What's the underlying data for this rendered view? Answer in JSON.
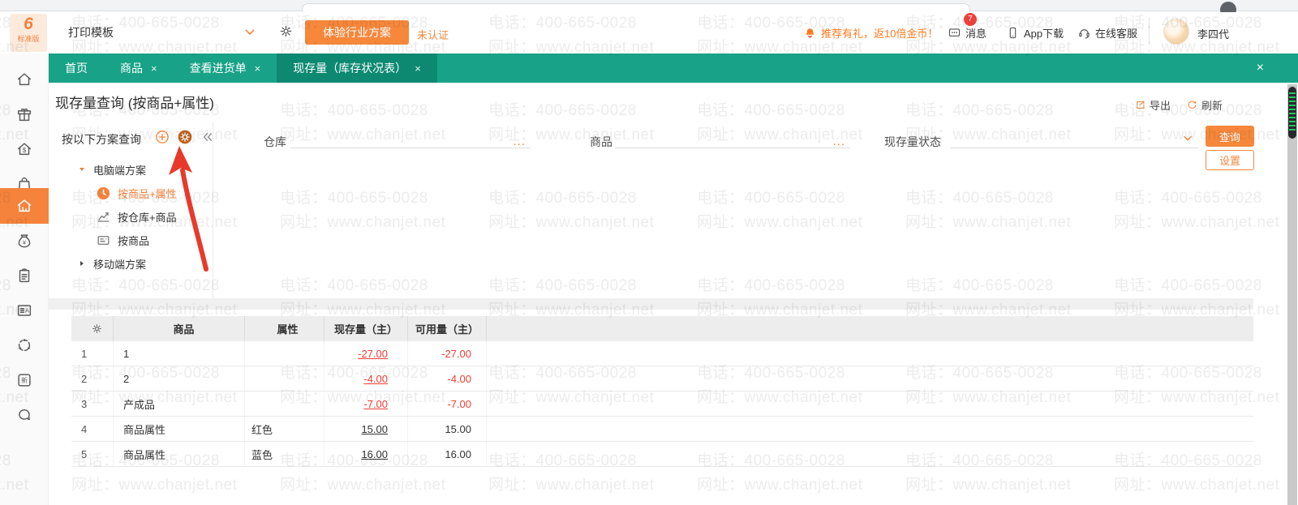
{
  "topbar": {
    "logo_glyph": "6",
    "edition": "标准版",
    "print_template": "打印模板",
    "trial_button": "体验行业方案",
    "unverified": "未认证",
    "promo": "推荐有礼，返10倍金币！",
    "messages": "消息",
    "messages_badge": "7",
    "app_download": "App下载",
    "online_service": "在线客服",
    "username": "李四代"
  },
  "tabbar": {
    "close_all": "×",
    "tabs": [
      {
        "label": "首页",
        "closable": false,
        "active": false
      },
      {
        "label": "商品",
        "closable": true,
        "active": false
      },
      {
        "label": "查看进货单",
        "closable": true,
        "active": false
      },
      {
        "label": "现存量（库存状况表）",
        "closable": true,
        "active": true
      }
    ]
  },
  "sidebar": {
    "items": [
      {
        "icon": "home-icon",
        "active": false
      },
      {
        "icon": "gift-icon",
        "active": false
      },
      {
        "icon": "sales-house-icon",
        "active": false
      },
      {
        "icon": "purchase-bag-icon",
        "active": false
      },
      {
        "icon": "warehouse-icon",
        "active": true
      },
      {
        "icon": "funds-moneybag-icon",
        "active": false
      },
      {
        "icon": "orders-clipboard-icon",
        "active": false
      },
      {
        "icon": "contacts-card-icon",
        "active": false
      },
      {
        "icon": "sync-network-icon",
        "active": false
      },
      {
        "icon": "new-features-icon",
        "active": false
      },
      {
        "icon": "feedback-chat-icon",
        "active": false
      }
    ]
  },
  "page": {
    "title": "现存量查询 (按商品+属性)",
    "export_label": "导出",
    "refresh_label": "刷新"
  },
  "scheme_panel": {
    "title": "按以下方案查询",
    "tree": [
      {
        "type": "group",
        "label": "电脑端方案",
        "expanded": true
      },
      {
        "type": "item",
        "label": "按商品+属性",
        "icon": "clock-icon",
        "selected": true
      },
      {
        "type": "item",
        "label": "按仓库+商品",
        "icon": "trend-chart-icon",
        "selected": false
      },
      {
        "type": "item",
        "label": "按商品",
        "icon": "card-list-icon",
        "selected": false
      },
      {
        "type": "group",
        "label": "移动端方案",
        "expanded": false
      }
    ]
  },
  "filters": {
    "warehouse_label": "仓库",
    "product_label": "商品",
    "status_label": "现存量状态",
    "more_label": "...",
    "query_button": "查询",
    "settings_button": "设置"
  },
  "table": {
    "columns": [
      "商品",
      "属性",
      "现存量（主）",
      "可用量（主）"
    ],
    "rows": [
      {
        "no": "1",
        "product": "1",
        "attr": "",
        "qty": "-27.00",
        "avail": "-27.00",
        "negative": true
      },
      {
        "no": "2",
        "product": "2",
        "attr": "",
        "qty": "-4.00",
        "avail": "-4.00",
        "negative": true
      },
      {
        "no": "3",
        "product": "产成品",
        "attr": "",
        "qty": "-7.00",
        "avail": "-7.00",
        "negative": true
      },
      {
        "no": "4",
        "product": "商品属性",
        "attr": "红色",
        "qty": "15.00",
        "avail": "15.00",
        "negative": false
      },
      {
        "no": "5",
        "product": "商品属性",
        "attr": "蓝色",
        "qty": "16.00",
        "avail": "16.00",
        "negative": false
      }
    ]
  },
  "watermark": {
    "line1": "电话：400-665-0028",
    "line2": "网址：www.chanjet.net"
  },
  "colors": {
    "teal": "#18A287",
    "teal_dark": "#0D8972",
    "orange": "#F6873B",
    "orange_active": "#F5833C",
    "gear_bg": "#C2641F",
    "red": "#EE4037",
    "promo_orange": "#FF7A1F",
    "badge_red": "#F3413C",
    "arrow_red": "#E8392B"
  }
}
